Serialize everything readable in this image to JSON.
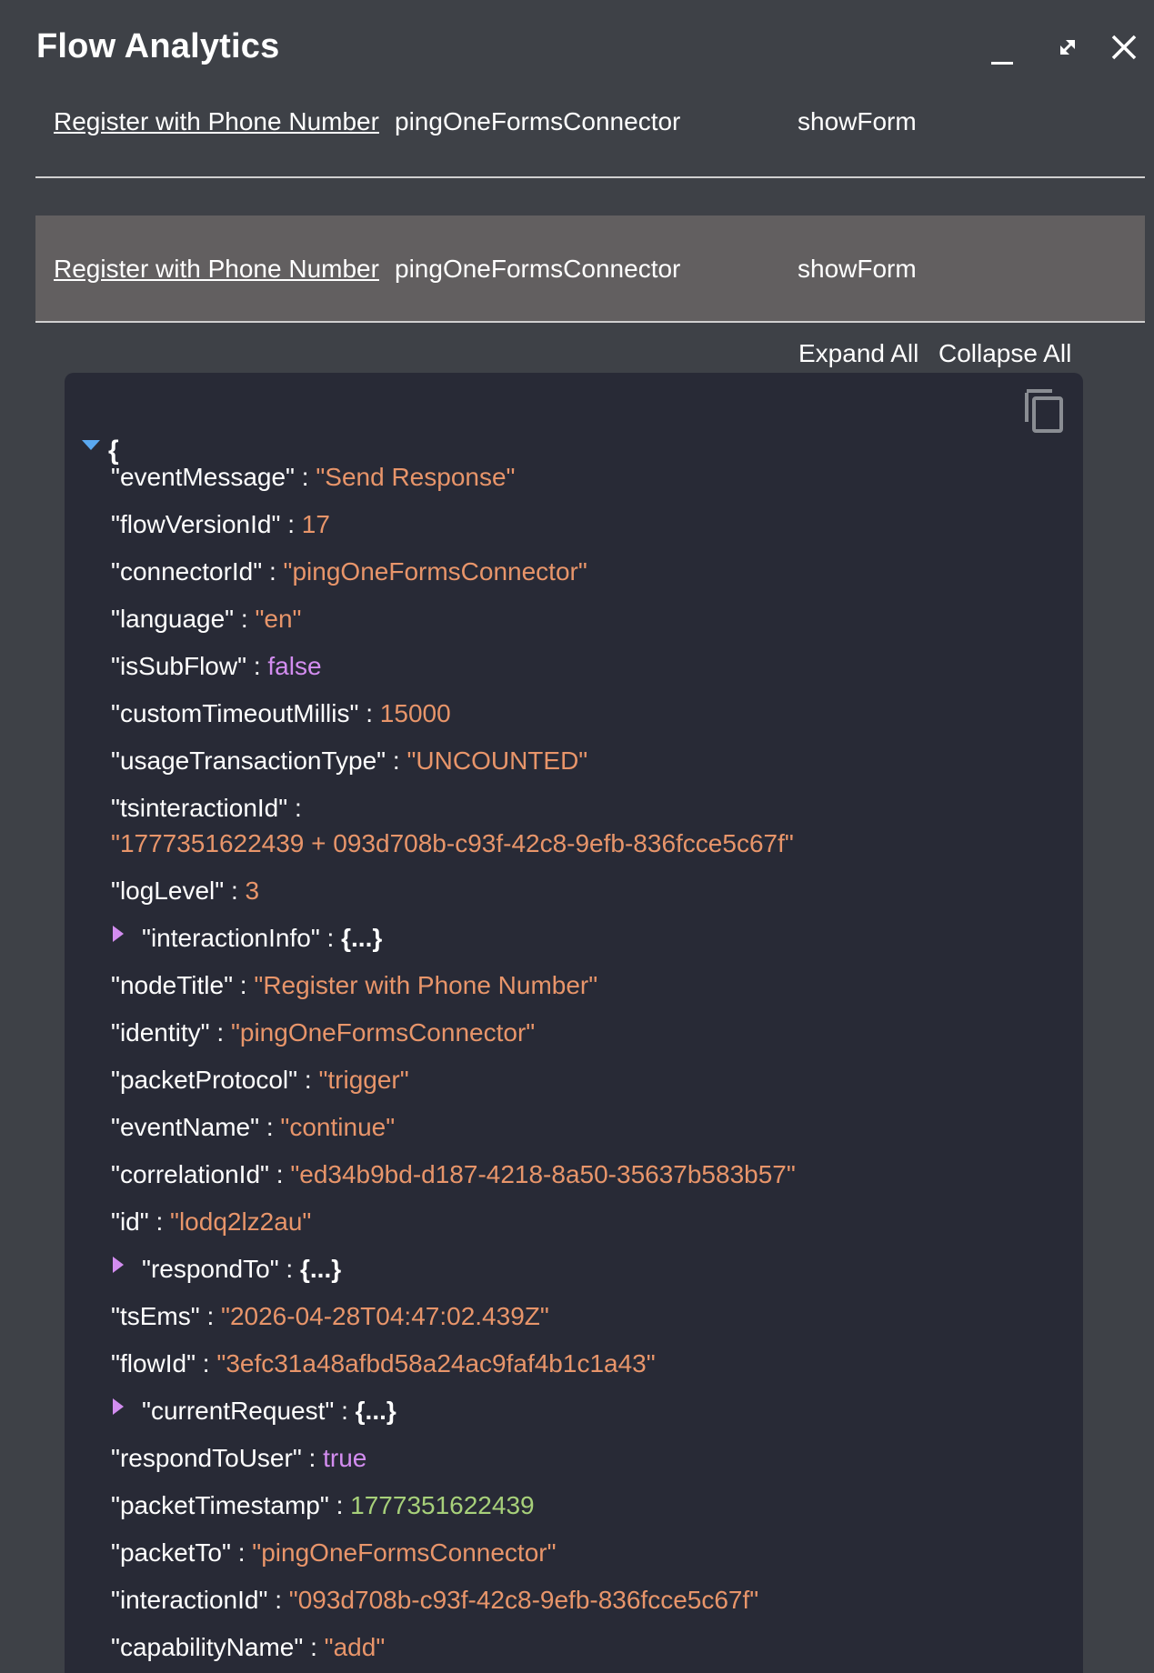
{
  "window": {
    "title": "Flow Analytics",
    "controls": [
      "minimize-icon",
      "maximize-icon",
      "close-icon"
    ]
  },
  "rows": [
    {
      "node": "Register with Phone Number",
      "connector": "pingOneFormsConnector",
      "capability": "showForm",
      "selected": false
    },
    {
      "node": "Register with Phone Number",
      "connector": "pingOneFormsConnector",
      "capability": "showForm",
      "selected": true
    }
  ],
  "toolbar": {
    "expand_all": "Expand All",
    "collapse_all": "Collapse All"
  },
  "json": {
    "open_brace": "{",
    "collapsed_value": "{...}",
    "sep": ":",
    "lines": [
      {
        "key": "\"eventMessage\"",
        "value": "\"Send Response\""
      },
      {
        "key": "\"flowVersionId\"",
        "value": "17"
      },
      {
        "key": "\"connectorId\"",
        "value": "\"pingOneFormsConnector\""
      },
      {
        "key": "\"language\"",
        "value": "\"en\""
      },
      {
        "key": "\"isSubFlow\"",
        "value": "false"
      },
      {
        "key": "\"customTimeoutMillis\"",
        "value": "15000"
      },
      {
        "key": "\"usageTransactionType\"",
        "value": "\"UNCOUNTED\""
      },
      {
        "key": "\"tsinteractionId\"",
        "value": "\"1777351622439 + 093d708b-c93f-42c8-9efb-836fcce5c67f\""
      },
      {
        "key": "\"logLevel\"",
        "value": "3"
      },
      {
        "key": "\"interactionInfo\""
      },
      {
        "key": "\"nodeTitle\"",
        "value": "\"Register with Phone Number\""
      },
      {
        "key": "\"identity\"",
        "value": "\"pingOneFormsConnector\""
      },
      {
        "key": "\"packetProtocol\"",
        "value": "\"trigger\""
      },
      {
        "key": "\"eventName\"",
        "value": "\"continue\""
      },
      {
        "key": "\"correlationId\"",
        "value": "\"ed34b9bd-d187-4218-8a50-35637b583b57\""
      },
      {
        "key": "\"id\"",
        "value": "\"lodq2lz2au\""
      },
      {
        "key": "\"respondTo\""
      },
      {
        "key": "\"tsEms\"",
        "value": "\"2026-04-28T04:47:02.439Z\""
      },
      {
        "key": "\"flowId\"",
        "value": "\"3efc31a48afbd58a24ac9faf4b1c1a43\""
      },
      {
        "key": "\"currentRequest\""
      },
      {
        "key": "\"respondToUser\"",
        "value": "true"
      },
      {
        "key": "\"packetTimestamp\"",
        "value": "1777351622439"
      },
      {
        "key": "\"packetTo\"",
        "value": "\"pingOneFormsConnector\""
      },
      {
        "key": "\"interactionId\"",
        "value": "\"093d708b-c93f-42c8-9efb-836fcce5c67f\""
      },
      {
        "key": "\"capabilityName\"",
        "value": "\"add\""
      }
    ]
  },
  "colors": {
    "panel_bg": "#3e4147",
    "selected_row_bg": "#625f60",
    "json_bg": "#282a36",
    "string": "#e8956a",
    "boolean": "#d38df0",
    "timestamp": "#a7d07a",
    "triangle_open": "#5aa8f0",
    "triangle_closed": "#d38df0"
  }
}
